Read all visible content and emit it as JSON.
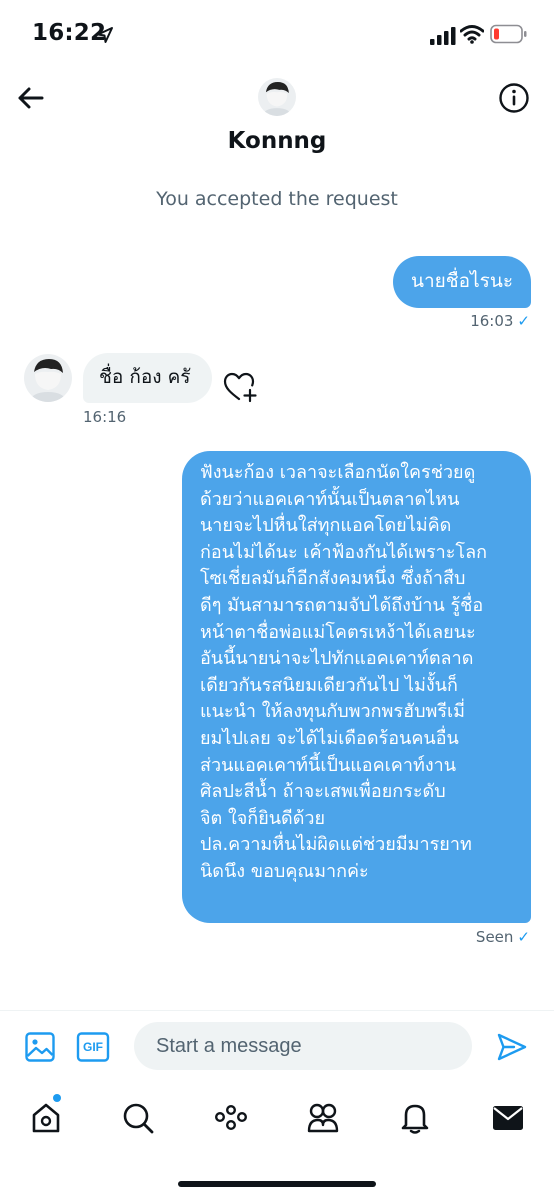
{
  "status_bar": {
    "time": "16:22",
    "icons": [
      "location-arrow-icon",
      "cellular-signal-icon",
      "wifi-icon",
      "battery-low-icon"
    ],
    "battery_color": "#ff3b30"
  },
  "header": {
    "contact_name": "Konnng",
    "back_icon": "back-arrow-icon",
    "info_icon": "info-icon"
  },
  "conversation": {
    "system_message": "You accepted the request",
    "messages": [
      {
        "direction": "outgoing",
        "text": "นายชื่อไรนะ",
        "time": "16:03",
        "status_icon": "check-icon"
      },
      {
        "direction": "incoming",
        "text": "ชื่อ ก้อง ครั",
        "time": "16:16"
      },
      {
        "direction": "outgoing",
        "lines": [
          "ฟังนะก้อง เวลาจะเลือกนัดใครช่วยดู",
          "ด้วยว่าแอคเคาท์นั้นเป็นตลาดไหน",
          "นายจะไปหื่นใส่ทุกแอคโดยไม่คิด",
          "ก่อนไม่ได้นะ เค้าฟ้องกันได้เพราะโลก",
          "โซเชี่ยลมันก็อีกสังคมหนึ่ง ซึ่งถ้าสืบ",
          "ดีๆ มันสามารถตามจับได้ถึงบ้าน รู้ชื่อ",
          "หน้าตาชื่อพ่อแม่โคตรเหง้าได้เลยนะ",
          "อันนี้นายน่าจะไปทักแอคเคาท์ตลาด",
          "เดียวกันรสนิยมเดียวกันไป ไม่งั้นก็",
          "แนะนำ ให้ลงทุนกับพวกพรฮับพรีเมี่",
          "ยมไปเลย  จะได้ไม่เดือดร้อนคนอื่น",
          "ส่วนแอคเคาท์นี้เป็นแอคเคาท์งาน",
          "ศิลปะสีน้ำ ถ้าจะเสพเพื่อยกระดับ",
          "จิต ใจก็ยินดีด้วย",
          "ปล.ความหื่นไม่ผิดแต่ช่วยมีมารยาท",
          "นิดนึง ขอบคุณมากค่ะ"
        ],
        "status": "Seen",
        "status_icon": "check-icon"
      }
    ]
  },
  "composer": {
    "placeholder": "Start a message",
    "gif_label": "GIF",
    "icons": [
      "image-icon",
      "gif-icon",
      "send-icon"
    ]
  },
  "bottom_nav": {
    "items": [
      "home-icon",
      "search-icon",
      "spaces-icon",
      "communities-icon",
      "notifications-icon",
      "messages-icon"
    ],
    "active": "messages-icon",
    "notification_dot_color": "#1d9bf0"
  },
  "colors": {
    "accent": "#1d9bf0",
    "outgoing_bubble": "#4ca4ea",
    "incoming_bubble": "#eff3f4",
    "secondary_text": "#536471"
  }
}
